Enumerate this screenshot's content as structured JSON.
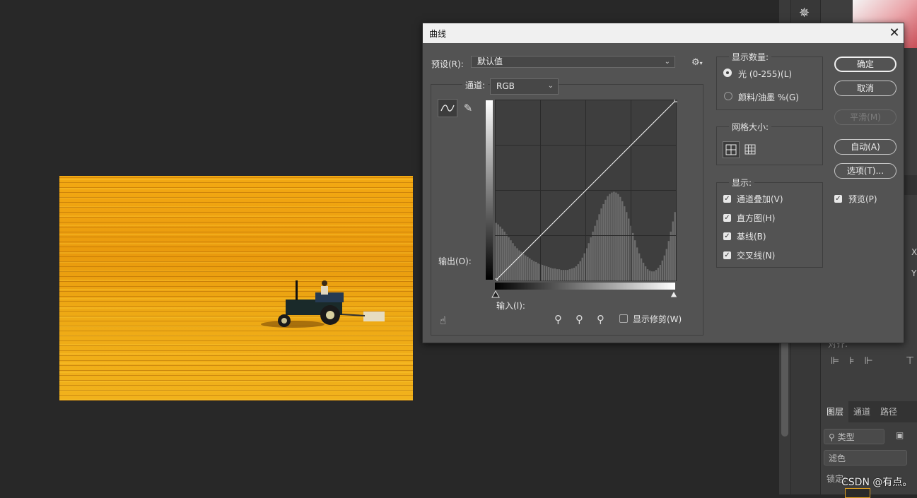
{
  "dialog": {
    "title": "曲线",
    "close_icon": "close-icon",
    "preset_label": "预设(R):",
    "preset_value": "默认值",
    "channel_label": "通道:",
    "channel_value": "RGB",
    "output_label": "输出(O):",
    "input_label": "输入(I):",
    "show_clipping_label": "显示修剪(W)",
    "show_clipping_checked": false
  },
  "show_amount": {
    "title": "显示数量:",
    "options": [
      {
        "label": "光 (0-255)(L)",
        "selected": true
      },
      {
        "label": "颜料/油墨 %(G)",
        "selected": false
      }
    ]
  },
  "grid_size": {
    "title": "网格大小:"
  },
  "show": {
    "title": "显示:",
    "options": [
      {
        "label": "通道叠加(V)",
        "checked": true
      },
      {
        "label": "直方图(H)",
        "checked": true
      },
      {
        "label": "基线(B)",
        "checked": true
      },
      {
        "label": "交叉线(N)",
        "checked": true
      }
    ]
  },
  "buttons": {
    "ok": "确定",
    "cancel": "取消",
    "smooth": "平滑(M)",
    "auto": "自动(A)",
    "options": "选项(T)..."
  },
  "preview": {
    "label": "预览(P)",
    "checked": true
  },
  "layers_panel": {
    "tabs": [
      "图层",
      "通道",
      "路径"
    ],
    "kind_filter": "类型",
    "blend_mode": "滤色",
    "lock_label": "锁定:",
    "align_label": "对齐:"
  },
  "watermark": "CSDN @有点。",
  "curve": {
    "points": [
      [
        0,
        0
      ],
      [
        255,
        255
      ]
    ],
    "histogram": [
      80,
      78,
      75,
      72,
      68,
      64,
      60,
      56,
      52,
      48,
      45,
      42,
      40,
      37,
      35,
      33,
      31,
      29,
      27,
      26,
      24,
      23,
      22,
      21,
      20,
      19,
      18,
      17,
      17,
      16,
      16,
      15,
      15,
      15,
      15,
      16,
      17,
      18,
      20,
      23,
      27,
      32,
      38,
      45,
      52,
      60,
      68,
      76,
      84,
      92,
      100,
      106,
      112,
      117,
      120,
      122,
      123,
      122,
      120,
      116,
      110,
      103,
      95,
      86,
      76,
      66,
      56,
      46,
      38,
      31,
      25,
      20,
      16,
      14,
      13,
      13,
      15,
      18,
      22,
      28,
      35,
      44,
      55,
      68,
      82,
      95
    ]
  }
}
